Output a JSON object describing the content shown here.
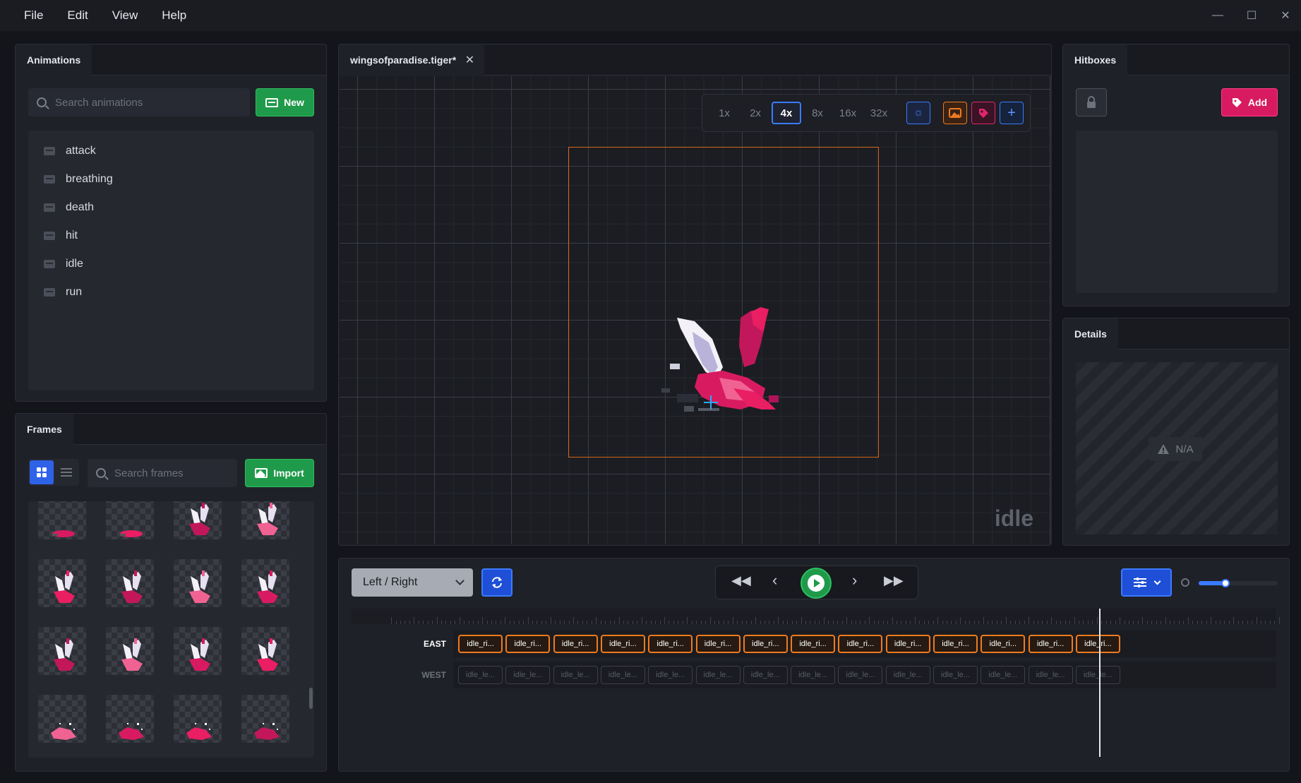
{
  "menu": [
    "File",
    "Edit",
    "View",
    "Help"
  ],
  "window_controls": {
    "minimize": "—",
    "maximize": "☐",
    "close": "✕"
  },
  "animations_panel": {
    "tab": "Animations",
    "search_placeholder": "Search animations",
    "new_label": "New",
    "items": [
      "attack",
      "breathing",
      "death",
      "hit",
      "idle",
      "run"
    ]
  },
  "frames_panel": {
    "tab": "Frames",
    "search_placeholder": "Search frames",
    "import_label": "Import"
  },
  "editor": {
    "tab_title": "wingsofparadise.tiger*",
    "zoom_levels": [
      "1x",
      "2x",
      "4x",
      "8x",
      "16x",
      "32x"
    ],
    "active_zoom": "4x",
    "animation_label": "idle"
  },
  "hitboxes_panel": {
    "tab": "Hitboxes",
    "add_label": "Add"
  },
  "details_panel": {
    "tab": "Details",
    "na_label": "N/A"
  },
  "timeline": {
    "direction_select": "Left / Right",
    "tracks": [
      {
        "name": "EAST",
        "frames": [
          "idle_ri...",
          "idle_ri...",
          "idle_ri...",
          "idle_ri...",
          "idle_ri...",
          "idle_ri...",
          "idle_ri...",
          "idle_ri...",
          "idle_ri...",
          "idle_ri...",
          "idle_ri...",
          "idle_ri...",
          "idle_ri...",
          "idle_ri..."
        ]
      },
      {
        "name": "WEST",
        "frames": [
          "idle_le...",
          "idle_le...",
          "idle_le...",
          "idle_le...",
          "idle_le...",
          "idle_le...",
          "idle_le...",
          "idle_le...",
          "idle_le...",
          "idle_le...",
          "idle_le...",
          "idle_le...",
          "idle_le...",
          "idle_le..."
        ]
      }
    ]
  },
  "colors": {
    "accent_blue": "#3b7bff",
    "green": "#1f9a4a",
    "orange": "#f07a1f",
    "pink": "#e0246d"
  }
}
